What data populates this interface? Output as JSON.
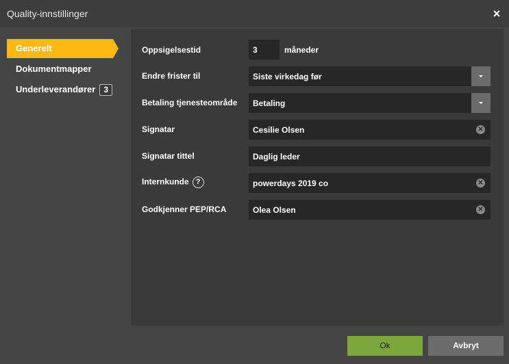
{
  "window": {
    "title": "Quality-innstillinger",
    "close_symbol": "×"
  },
  "sidebar": {
    "items": [
      {
        "label": "Generelt",
        "active": true
      },
      {
        "label": "Dokumentmapper",
        "active": false
      },
      {
        "label": "Underleverandører",
        "badge": "3",
        "active": false
      }
    ]
  },
  "form": {
    "notice_period": {
      "label": "Oppsigelsestid",
      "value": "3",
      "unit": "måneder"
    },
    "change_deadline": {
      "label": "Endre frister til",
      "value": "Siste virkedag før"
    },
    "payment_service_area": {
      "label": "Betaling tjenesteområde",
      "value": "Betaling"
    },
    "signatory": {
      "label": "Signatar",
      "value": "Cesilie Olsen"
    },
    "signatory_title": {
      "label": "Signatar tittel",
      "value": "Daglig leder"
    },
    "internal_customer": {
      "label": "Internkunde",
      "value": "powerdays 2019 co",
      "help_symbol": "?"
    },
    "pep_approver": {
      "label": "Godkjenner PEP/RCA",
      "value": "Olea Olsen"
    }
  },
  "buttons": {
    "ok": "Ok",
    "cancel": "Avbryt"
  },
  "colors": {
    "accent": "#fdb813",
    "ok_button": "#7ca73d",
    "panel": "#3a3a3a",
    "field": "#272727"
  }
}
